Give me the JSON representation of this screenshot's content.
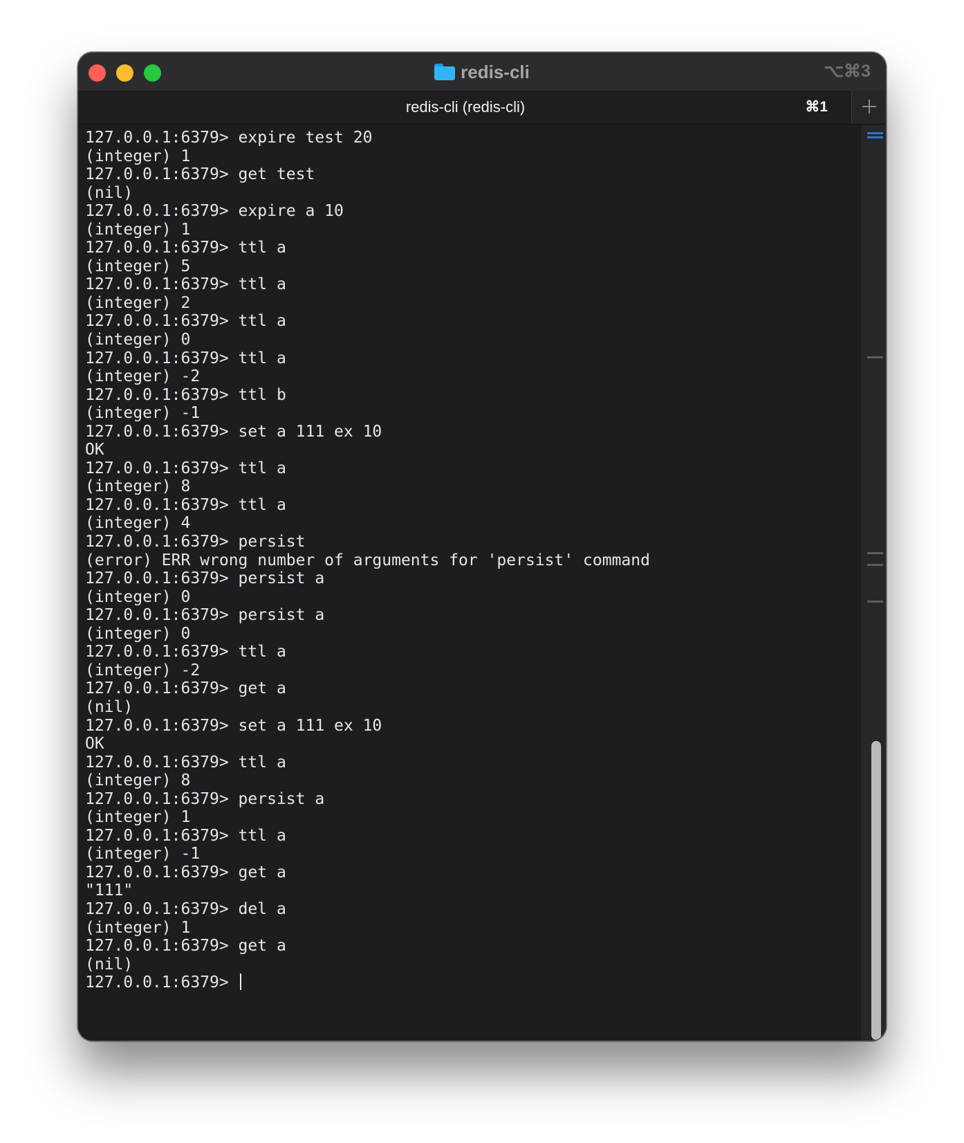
{
  "window": {
    "title": "redis-cli",
    "shortcut": "⌥⌘3"
  },
  "tab": {
    "label": "redis-cli (redis-cli)",
    "shortcut": "⌘1"
  },
  "terminal": {
    "lines": [
      "127.0.0.1:6379> expire test 20",
      "(integer) 1",
      "127.0.0.1:6379> get test",
      "(nil)",
      "127.0.0.1:6379> expire a 10",
      "(integer) 1",
      "127.0.0.1:6379> ttl a",
      "(integer) 5",
      "127.0.0.1:6379> ttl a",
      "(integer) 2",
      "127.0.0.1:6379> ttl a",
      "(integer) 0",
      "127.0.0.1:6379> ttl a",
      "(integer) -2",
      "127.0.0.1:6379> ttl b",
      "(integer) -1",
      "127.0.0.1:6379> set a 111 ex 10",
      "OK",
      "127.0.0.1:6379> ttl a",
      "(integer) 8",
      "127.0.0.1:6379> ttl a",
      "(integer) 4",
      "127.0.0.1:6379> persist",
      "(error) ERR wrong number of arguments for 'persist' command",
      "127.0.0.1:6379> persist a",
      "(integer) 0",
      "127.0.0.1:6379> persist a",
      "(integer) 0",
      "127.0.0.1:6379> ttl a",
      "(integer) -2",
      "127.0.0.1:6379> get a",
      "(nil)",
      "127.0.0.1:6379> set a 111 ex 10",
      "OK",
      "127.0.0.1:6379> ttl a",
      "(integer) 8",
      "127.0.0.1:6379> persist a",
      "(integer) 1",
      "127.0.0.1:6379> ttl a",
      "(integer) -1",
      "127.0.0.1:6379> get a",
      "\"111\"",
      "127.0.0.1:6379> del a",
      "(integer) 1",
      "127.0.0.1:6379> get a",
      "(nil)"
    ],
    "prompt": "127.0.0.1:6379> "
  },
  "colors": {
    "background": "#1b1d21",
    "text": "#e6e6e6",
    "close": "#fe5f57",
    "minimize": "#febc2e",
    "zoom": "#28c840",
    "folder": "#35b4f4"
  },
  "icons": [
    "folder-icon",
    "plus-icon"
  ]
}
